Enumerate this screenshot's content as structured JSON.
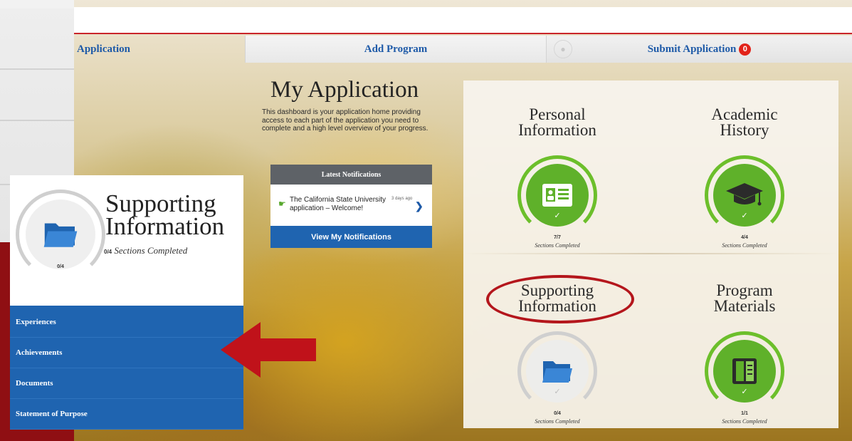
{
  "tabs": {
    "application": "Application",
    "add_program": "Add Program",
    "submit_application": "Submit Application",
    "submit_badge": "0"
  },
  "intro": {
    "title": "My Application",
    "text": "This dashboard is your application home providing access to each part of the application you need to complete and a high level overview of your progress."
  },
  "notifications": {
    "header": "Latest Notifications",
    "item_text": "The California State University application – Welcome!",
    "item_time": "3 days ago",
    "button": "View My Notifications"
  },
  "tiles": {
    "personal": {
      "title_line1": "Personal",
      "title_line2": "Information",
      "fraction": "7/7",
      "caption": "Sections Completed",
      "icon": "id-card-icon",
      "progress": 1.0
    },
    "academic": {
      "title_line1": "Academic",
      "title_line2": "History",
      "fraction": "4/4",
      "caption": "Sections Completed",
      "icon": "graduation-cap-icon",
      "progress": 1.0
    },
    "supporting": {
      "title_line1": "Supporting",
      "title_line2": "Information",
      "fraction": "0/4",
      "caption": "Sections Completed",
      "icon": "folder-icon",
      "progress": 0.0
    },
    "program": {
      "title_line1": "Program",
      "title_line2": "Materials",
      "fraction": "1/1",
      "caption": "Sections Completed",
      "icon": "book-icon",
      "progress": 1.0
    }
  },
  "callout": {
    "title_line1": "Supporting",
    "title_line2": "Information",
    "fraction_small": "0/4",
    "subtitle_num": "0/4",
    "subtitle_text": "Sections Completed",
    "menu": [
      "Experiences",
      "Achievements",
      "Documents",
      "Statement of Purpose"
    ]
  },
  "colors": {
    "accent_blue": "#1f64b0",
    "complete_green": "#5fb12a",
    "highlight_red": "#b4161c",
    "frame_red": "#9e1115"
  }
}
